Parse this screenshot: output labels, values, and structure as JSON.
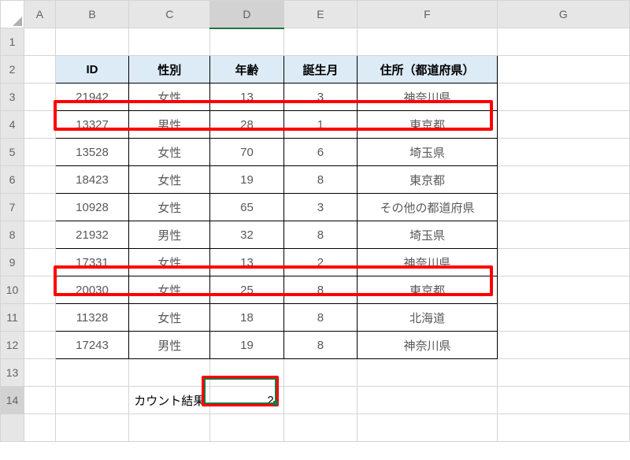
{
  "columns": [
    "A",
    "B",
    "C",
    "D",
    "E",
    "F",
    "G"
  ],
  "row_count": 15,
  "selected_column": "D",
  "selected_row": 14,
  "headers": {
    "B": "ID",
    "C": "性別",
    "D": "年齢",
    "E": "誕生月",
    "F": "住所（都道府県）"
  },
  "rows": [
    {
      "r": 3,
      "B": "21942",
      "C": "女性",
      "D": "13",
      "E": "3",
      "F": "神奈川県"
    },
    {
      "r": 4,
      "B": "13327",
      "C": "男性",
      "D": "28",
      "E": "1",
      "F": "東京都",
      "highlight": true
    },
    {
      "r": 5,
      "B": "13528",
      "C": "女性",
      "D": "70",
      "E": "6",
      "F": "埼玉県"
    },
    {
      "r": 6,
      "B": "18423",
      "C": "女性",
      "D": "19",
      "E": "8",
      "F": "東京都"
    },
    {
      "r": 7,
      "B": "10928",
      "C": "女性",
      "D": "65",
      "E": "3",
      "F": "その他の都道府県"
    },
    {
      "r": 8,
      "B": "21932",
      "C": "男性",
      "D": "32",
      "E": "8",
      "F": "埼玉県"
    },
    {
      "r": 9,
      "B": "17331",
      "C": "女性",
      "D": "13",
      "E": "2",
      "F": "神奈川県"
    },
    {
      "r": 10,
      "B": "20030",
      "C": "女性",
      "D": "25",
      "E": "8",
      "F": "東京都",
      "highlight": true
    },
    {
      "r": 11,
      "B": "11328",
      "C": "女性",
      "D": "18",
      "E": "8",
      "F": "北海道"
    },
    {
      "r": 12,
      "B": "17243",
      "C": "男性",
      "D": "19",
      "E": "8",
      "F": "神奈川県"
    }
  ],
  "result_label": "カウント結果",
  "result_value": "2",
  "active_cell": "D14"
}
